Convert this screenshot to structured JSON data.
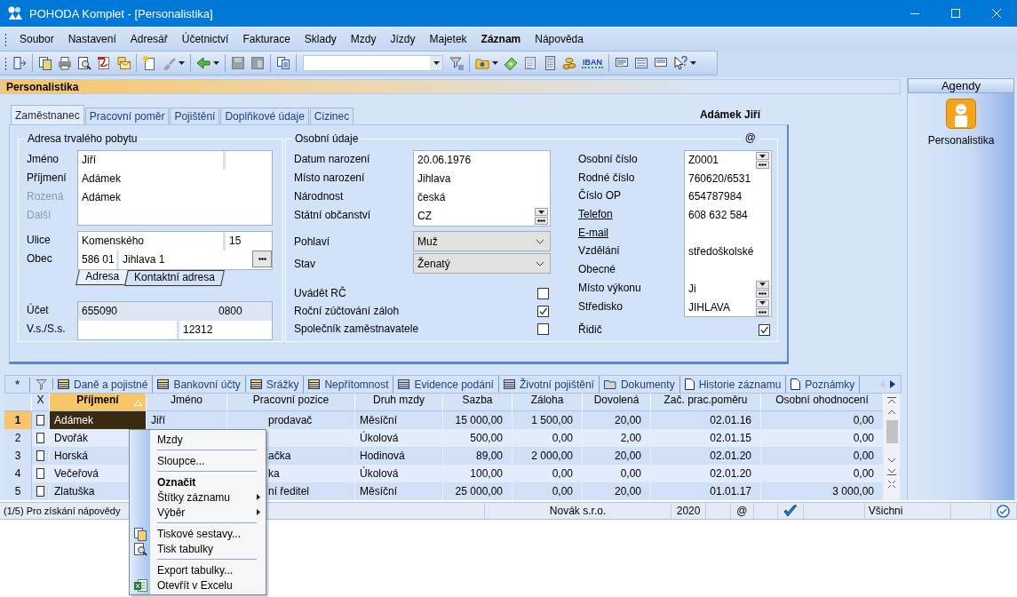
{
  "window": {
    "title": "POHODA Komplet - [Personalistika]"
  },
  "menu": [
    {
      "label": "Soubor",
      "bold": false
    },
    {
      "label": "Nastavení",
      "bold": false
    },
    {
      "label": "Adresář",
      "bold": false
    },
    {
      "label": "Účetnictví",
      "bold": false
    },
    {
      "label": "Fakturace",
      "bold": false
    },
    {
      "label": "Sklady",
      "bold": false
    },
    {
      "label": "Mzdy",
      "bold": false
    },
    {
      "label": "Jízdy",
      "bold": false
    },
    {
      "label": "Majetek",
      "bold": false
    },
    {
      "label": "Záznam",
      "bold": true
    },
    {
      "label": "Nápověda",
      "bold": false
    }
  ],
  "toolbar": {
    "iban_label": "IBAN"
  },
  "agenda": {
    "title": "Personalistika",
    "record_name": "Adámek Jiří"
  },
  "tabs": [
    {
      "label": "Zaměstnanec",
      "selected": true
    },
    {
      "label": "Pracovní poměr",
      "selected": false
    },
    {
      "label": "Pojištění",
      "selected": false
    },
    {
      "label": "Doplňkové údaje",
      "selected": false
    },
    {
      "label": "Cizinec",
      "selected": false
    }
  ],
  "address": {
    "title": "Adresa trvalého pobytu",
    "name_rows": [
      {
        "label": "Jméno",
        "disabled": false,
        "value": "Jiří"
      },
      {
        "label": "Příjmení",
        "disabled": false,
        "value": "Adámek"
      },
      {
        "label": "Rozená",
        "disabled": true,
        "value": "Adámek"
      },
      {
        "label": "Další",
        "disabled": true
      }
    ],
    "street": {
      "label": "Ulice",
      "value": "Komenského",
      "number": "15"
    },
    "city": {
      "label": "Obec",
      "zip": "586 01",
      "value": "Jihlava 1"
    },
    "address_tabs": [
      {
        "label": "Adresa",
        "selected": true
      },
      {
        "label": "Kontaktní adresa",
        "selected": false
      }
    ],
    "account": {
      "label": "Účet",
      "value": "655090",
      "bank_code": "0800"
    },
    "symbols": {
      "label": "V.s./S.s.",
      "specific": "12312"
    }
  },
  "personal": {
    "title": "Osobní údaje",
    "email_mark": "@",
    "fields": [
      {
        "label": "Datum narození",
        "value": "20.06.1976",
        "picker": false
      },
      {
        "label": "Místo narození",
        "value": "Jihlava",
        "picker": false
      },
      {
        "label": "Národnost",
        "value": "česká",
        "picker": false
      },
      {
        "label": "Státní občanství",
        "value": "CZ",
        "picker": true
      }
    ],
    "selects": [
      {
        "label": "Pohlaví",
        "value": "Muž"
      },
      {
        "label": "Stav",
        "value": "Ženatý"
      }
    ],
    "checks": [
      {
        "label": "Uvádět RČ",
        "checked": false
      },
      {
        "label": "Roční zúčtování záloh",
        "checked": true
      },
      {
        "label": "Společník zaměstnavatele",
        "checked": false
      }
    ],
    "ids": [
      {
        "label": "Osobní číslo",
        "value": "Z0001",
        "kind": "text",
        "picker": true
      },
      {
        "label": "Rodné číslo",
        "value": "760620/6531",
        "kind": "text",
        "picker": false
      },
      {
        "label": "Číslo OP",
        "value": "654787984",
        "kind": "text",
        "picker": false
      },
      {
        "label": "Telefon",
        "value": "608 632 584",
        "kind": "link",
        "picker": false
      },
      {
        "label": "E-mail",
        "kind": "link",
        "picker": false
      },
      {
        "label": "Vzdělání",
        "value": "středoškolské",
        "kind": "text",
        "picker": false
      },
      {
        "label": "Obecné",
        "kind": "text",
        "picker": false
      },
      {
        "label": "Místo výkonu",
        "value": "Ji",
        "kind": "text",
        "picker": true
      },
      {
        "label": "Středisko",
        "value": "JIHLAVA",
        "kind": "text",
        "picker": true
      }
    ],
    "driver": {
      "label": "Řidič",
      "checked": true
    }
  },
  "agendas": {
    "title": "Agendy",
    "items": [
      {
        "label": "Personalistika"
      }
    ]
  },
  "detail_tabs": {
    "new_mark": "*",
    "tabs": [
      {
        "label": "Daně a pojistné",
        "kind": "table"
      },
      {
        "label": "Bankovní účty",
        "kind": "table"
      },
      {
        "label": "Srážky",
        "kind": "table"
      },
      {
        "label": "Nepřítomnost",
        "kind": "table"
      },
      {
        "label": "Evidence podání",
        "kind": "empty"
      },
      {
        "label": "Životní pojištění",
        "kind": "empty"
      },
      {
        "label": "Dokumenty",
        "kind": "folder"
      },
      {
        "label": "Historie záznamu",
        "kind": "page"
      },
      {
        "label": "Poznámky",
        "kind": "page"
      }
    ]
  },
  "table": {
    "columns": [
      {
        "label": "X",
        "sorted": false
      },
      {
        "label": "Příjmení",
        "sorted": true
      },
      {
        "label": "Jméno",
        "sorted": false
      },
      {
        "label": "Pracovní pozice",
        "sorted": false
      },
      {
        "label": "Druh mzdy",
        "sorted": false
      },
      {
        "label": "Sazba",
        "sorted": false
      },
      {
        "label": "Záloha",
        "sorted": false
      },
      {
        "label": "Dovolená",
        "sorted": false
      },
      {
        "label": "Zač. prac.poměru",
        "sorted": false
      },
      {
        "label": "Osobní ohodnocení",
        "sorted": false
      }
    ],
    "rows": [
      {
        "number": "1",
        "selected": true,
        "checked": false,
        "surname": "Adámek",
        "first_name": "Jiří",
        "position": "prodavač",
        "wage_type": "Měsíční",
        "rate": "15 000,00",
        "advance": "1 500,00",
        "leave": "20,00",
        "start": "02.01.16",
        "bonus": "0,00"
      },
      {
        "number": "2",
        "selected": false,
        "checked": false,
        "surname": "Dvořák",
        "wage_type": "Úkolová",
        "rate": "500,00",
        "advance": "0,00",
        "leave": "2,00",
        "start": "02.01.15",
        "bonus": "0,00"
      },
      {
        "number": "3",
        "selected": false,
        "checked": false,
        "surname": "Horská",
        "position": "ačka",
        "wage_type": "Hodinová",
        "rate": "89,00",
        "advance": "2 000,00",
        "leave": "20,00",
        "start": "02.01.20",
        "bonus": "0,00"
      },
      {
        "number": "4",
        "selected": false,
        "checked": false,
        "surname": "Večeřová",
        "position": "ka",
        "wage_type": "Úkolová",
        "rate": "100,00",
        "advance": "0,00",
        "leave": "0,00",
        "start": "02.01.20",
        "bonus": "0,00"
      },
      {
        "number": "5",
        "selected": false,
        "checked": false,
        "surname": "Zlatuška",
        "position": "ní ředitel",
        "wage_type": "Měsíční",
        "rate": "25 000,00",
        "advance": "0,00",
        "leave": "20,00",
        "start": "01.01.17",
        "bonus": "3 000,00"
      }
    ]
  },
  "status_bar": {
    "hint": "(1/5) Pro získání nápovědy",
    "company": "Novák s.r.o.",
    "year": "2020",
    "email_mark": "@",
    "filter": "Všichni"
  },
  "context_menu": [
    {
      "kind": "item",
      "label": "Mzdy",
      "bold": false,
      "submenu": false
    },
    {
      "kind": "separator"
    },
    {
      "kind": "item",
      "label": "Sloupce...",
      "bold": false,
      "submenu": false
    },
    {
      "kind": "separator"
    },
    {
      "kind": "item",
      "label": "Označit",
      "bold": true,
      "submenu": false
    },
    {
      "kind": "item",
      "label": "Štítky záznamu",
      "bold": false,
      "submenu": true
    },
    {
      "kind": "item",
      "label": "Výběr",
      "bold": false,
      "submenu": true
    },
    {
      "kind": "separator"
    },
    {
      "kind": "item",
      "label": "Tiskové sestavy...",
      "bold": false,
      "submenu": false
    },
    {
      "kind": "item",
      "label": "Tisk tabulky",
      "bold": false,
      "submenu": false
    },
    {
      "kind": "separator"
    },
    {
      "kind": "item",
      "label": "Export tabulky...",
      "bold": false,
      "submenu": false
    },
    {
      "kind": "item",
      "label": "Otevřít v Excelu",
      "bold": false,
      "submenu": false
    }
  ]
}
